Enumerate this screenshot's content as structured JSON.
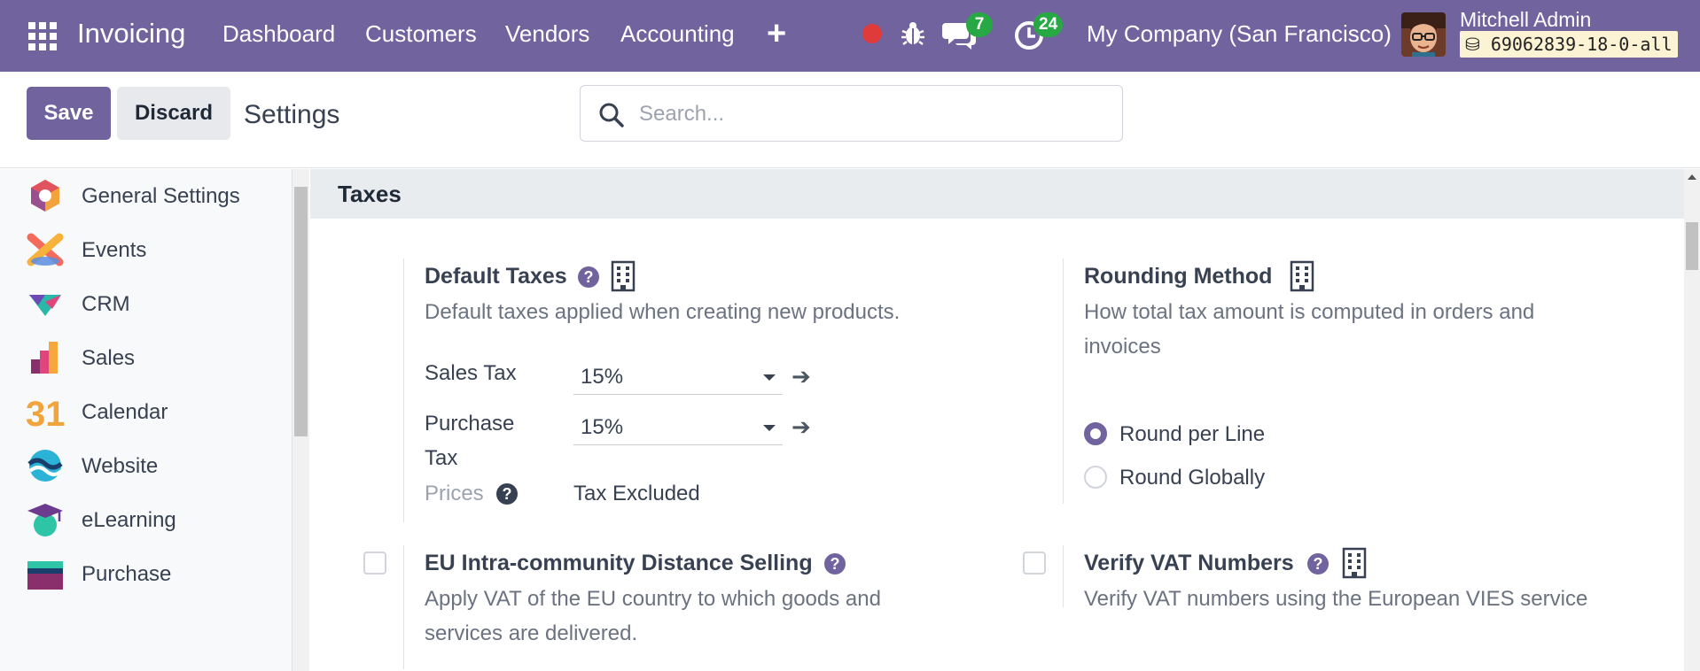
{
  "navbar": {
    "app_name": "Invoicing",
    "menu": [
      "Dashboard",
      "Customers",
      "Vendors",
      "Accounting"
    ],
    "add_label": "+",
    "messages_count": "7",
    "activities_count": "24",
    "company": "My Company (San Francisco)",
    "user_name": "Mitchell Admin",
    "db_name": "69062839-18-0-all",
    "colors": {
      "primary": "#71639e",
      "badge": "#28a745",
      "recording": "#e03b3b"
    }
  },
  "control": {
    "save_label": "Save",
    "discard_label": "Discard",
    "title": "Settings",
    "search_placeholder": "Search..."
  },
  "sidebar": {
    "items": [
      {
        "label": "General Settings",
        "icon": "general-settings-icon"
      },
      {
        "label": "Events",
        "icon": "events-icon"
      },
      {
        "label": "CRM",
        "icon": "crm-icon"
      },
      {
        "label": "Sales",
        "icon": "sales-icon"
      },
      {
        "label": "Calendar",
        "icon": "calendar-icon",
        "icon_text": "31"
      },
      {
        "label": "Website",
        "icon": "website-icon"
      },
      {
        "label": "eLearning",
        "icon": "elearning-icon"
      },
      {
        "label": "Purchase",
        "icon": "purchase-icon"
      }
    ]
  },
  "section": {
    "title": "Taxes",
    "default_taxes": {
      "title": "Default Taxes",
      "description": "Default taxes applied when creating new products.",
      "sales_tax_label": "Sales Tax",
      "sales_tax_value": "15%",
      "purchase_tax_label_1": "Purchase",
      "purchase_tax_label_2": "Tax",
      "purchase_tax_value": "15%",
      "prices_label": "Prices",
      "prices_value": "Tax Excluded"
    },
    "rounding": {
      "title": "Rounding Method",
      "description_1": "How total tax amount is computed in orders and",
      "description_2": "invoices",
      "options": [
        "Round per Line",
        "Round Globally"
      ],
      "selected": "Round per Line"
    },
    "eu_distance": {
      "title": "EU Intra-community Distance Selling",
      "description_1": "Apply VAT of the EU country to which goods and",
      "description_2": "services are delivered.",
      "checked": false
    },
    "verify_vat": {
      "title": "Verify VAT Numbers",
      "description": "Verify VAT numbers using the European VIES service",
      "checked": false
    }
  }
}
